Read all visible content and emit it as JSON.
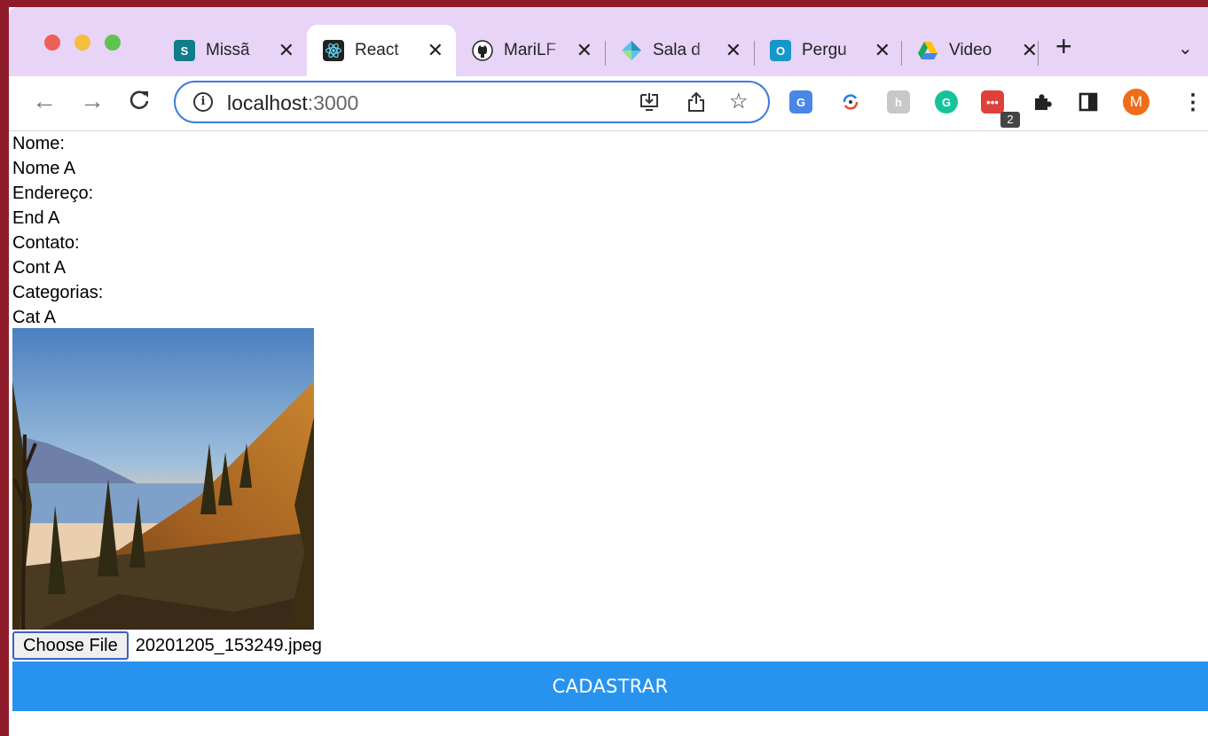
{
  "browser": {
    "tabs": [
      {
        "label": "Missã",
        "fav_text": "S",
        "fav_color": "#0f7d8a"
      },
      {
        "label": "React",
        "fav_text": "⚛",
        "fav_color": "#222222",
        "active": true
      },
      {
        "label": "MariLF",
        "fav_text": "",
        "fav_color": "#222222"
      },
      {
        "label": "Sala d",
        "fav_text": "",
        "fav_color": "#4aa8c8"
      },
      {
        "label": "Pergu",
        "fav_text": "O",
        "fav_color": "#1597c9"
      },
      {
        "label": "Video",
        "fav_text": "",
        "fav_color": "#2f9e54"
      }
    ],
    "close_glyph": "✕",
    "new_tab_glyph": "+",
    "tab_menu_glyph": "⌄",
    "url_host": "localhost",
    "url_port": ":3000",
    "profile_initial": "M",
    "extension_badge": "2",
    "icons": {
      "back": "arrow-left-icon",
      "forward": "arrow-right-icon",
      "reload": "reload-icon",
      "info": "info-icon",
      "install": "install-app-icon",
      "share": "share-icon",
      "bookmark": "star-icon"
    }
  },
  "form": {
    "fields": [
      {
        "label": "Nome:",
        "value": "Nome A"
      },
      {
        "label": "Endereço:",
        "value": "End A"
      },
      {
        "label": "Contato:",
        "value": "Cont A"
      },
      {
        "label": "Categorias:",
        "value": "Cat A"
      }
    ],
    "file_button_label": "Choose File",
    "file_name": "20201205_153249.jpeg",
    "submit_label": "CADASTRAR"
  },
  "colors": {
    "tabstrip": "#e8d4f7",
    "submit": "#2793ef",
    "omnibox_border": "#3c7be0"
  }
}
